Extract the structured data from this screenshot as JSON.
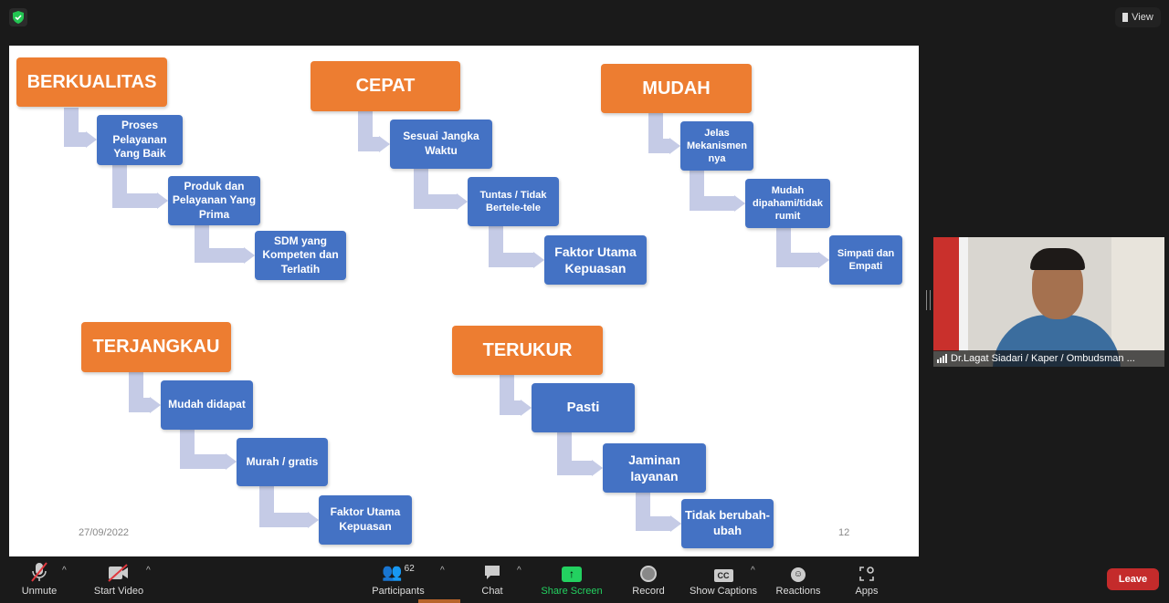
{
  "top_bar": {
    "view_label": "View",
    "security_icon": "shield-check-icon"
  },
  "slide": {
    "headers": [
      "BERKUALITAS",
      "CEPAT",
      "MUDAH",
      "TERJANGKAU",
      "TERUKUR"
    ],
    "berkualitas": [
      "Proses Pelayanan Yang Baik",
      "Produk dan Pelayanan Yang Prima",
      "SDM yang Kompeten dan Terlatih"
    ],
    "cepat": [
      "Sesuai Jangka Waktu",
      "Tuntas / Tidak Bertele-tele",
      "Faktor Utama Kepuasan"
    ],
    "mudah": [
      "Jelas Mekanismen nya",
      "Mudah dipahami/tidak rumit",
      "Simpati dan Empati"
    ],
    "terjangkau": [
      "Mudah didapat",
      "Murah / gratis",
      "Faktor Utama Kepuasan"
    ],
    "terukur": [
      "Pasti",
      "Jaminan layanan",
      "Tidak berubah-ubah"
    ],
    "date": "27/09/2022",
    "page_number": "12",
    "colors": {
      "header": "#ed7d31",
      "box": "#4472c4",
      "arrow": "#c5cbe6"
    }
  },
  "video": {
    "participant_name": "Dr.Lagat Siadari / Kaper / Ombudsman ..."
  },
  "toolbar": {
    "unmute": "Unmute",
    "start_video": "Start Video",
    "participants": "Participants",
    "participants_count": "62",
    "chat": "Chat",
    "share_screen": "Share Screen",
    "record": "Record",
    "show_captions": "Show Captions",
    "captions_icon_text": "CC",
    "reactions": "Reactions",
    "apps": "Apps",
    "leave": "Leave"
  }
}
